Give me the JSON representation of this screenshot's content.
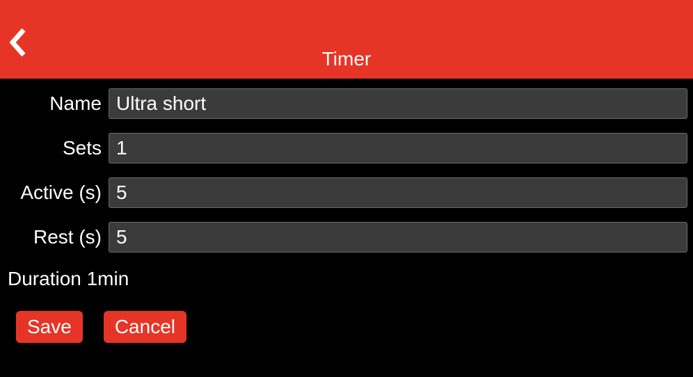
{
  "header": {
    "title": "Timer"
  },
  "form": {
    "name": {
      "label": "Name",
      "value": "Ultra short"
    },
    "sets": {
      "label": "Sets",
      "value": "1"
    },
    "active": {
      "label": "Active (s)",
      "value": "5"
    },
    "rest": {
      "label": "Rest (s)",
      "value": "5"
    }
  },
  "duration": {
    "text": "Duration 1min"
  },
  "buttons": {
    "save": "Save",
    "cancel": "Cancel"
  },
  "colors": {
    "accent": "#e63526",
    "input_bg": "#3b3b3b",
    "input_border": "#6a6a6a"
  }
}
